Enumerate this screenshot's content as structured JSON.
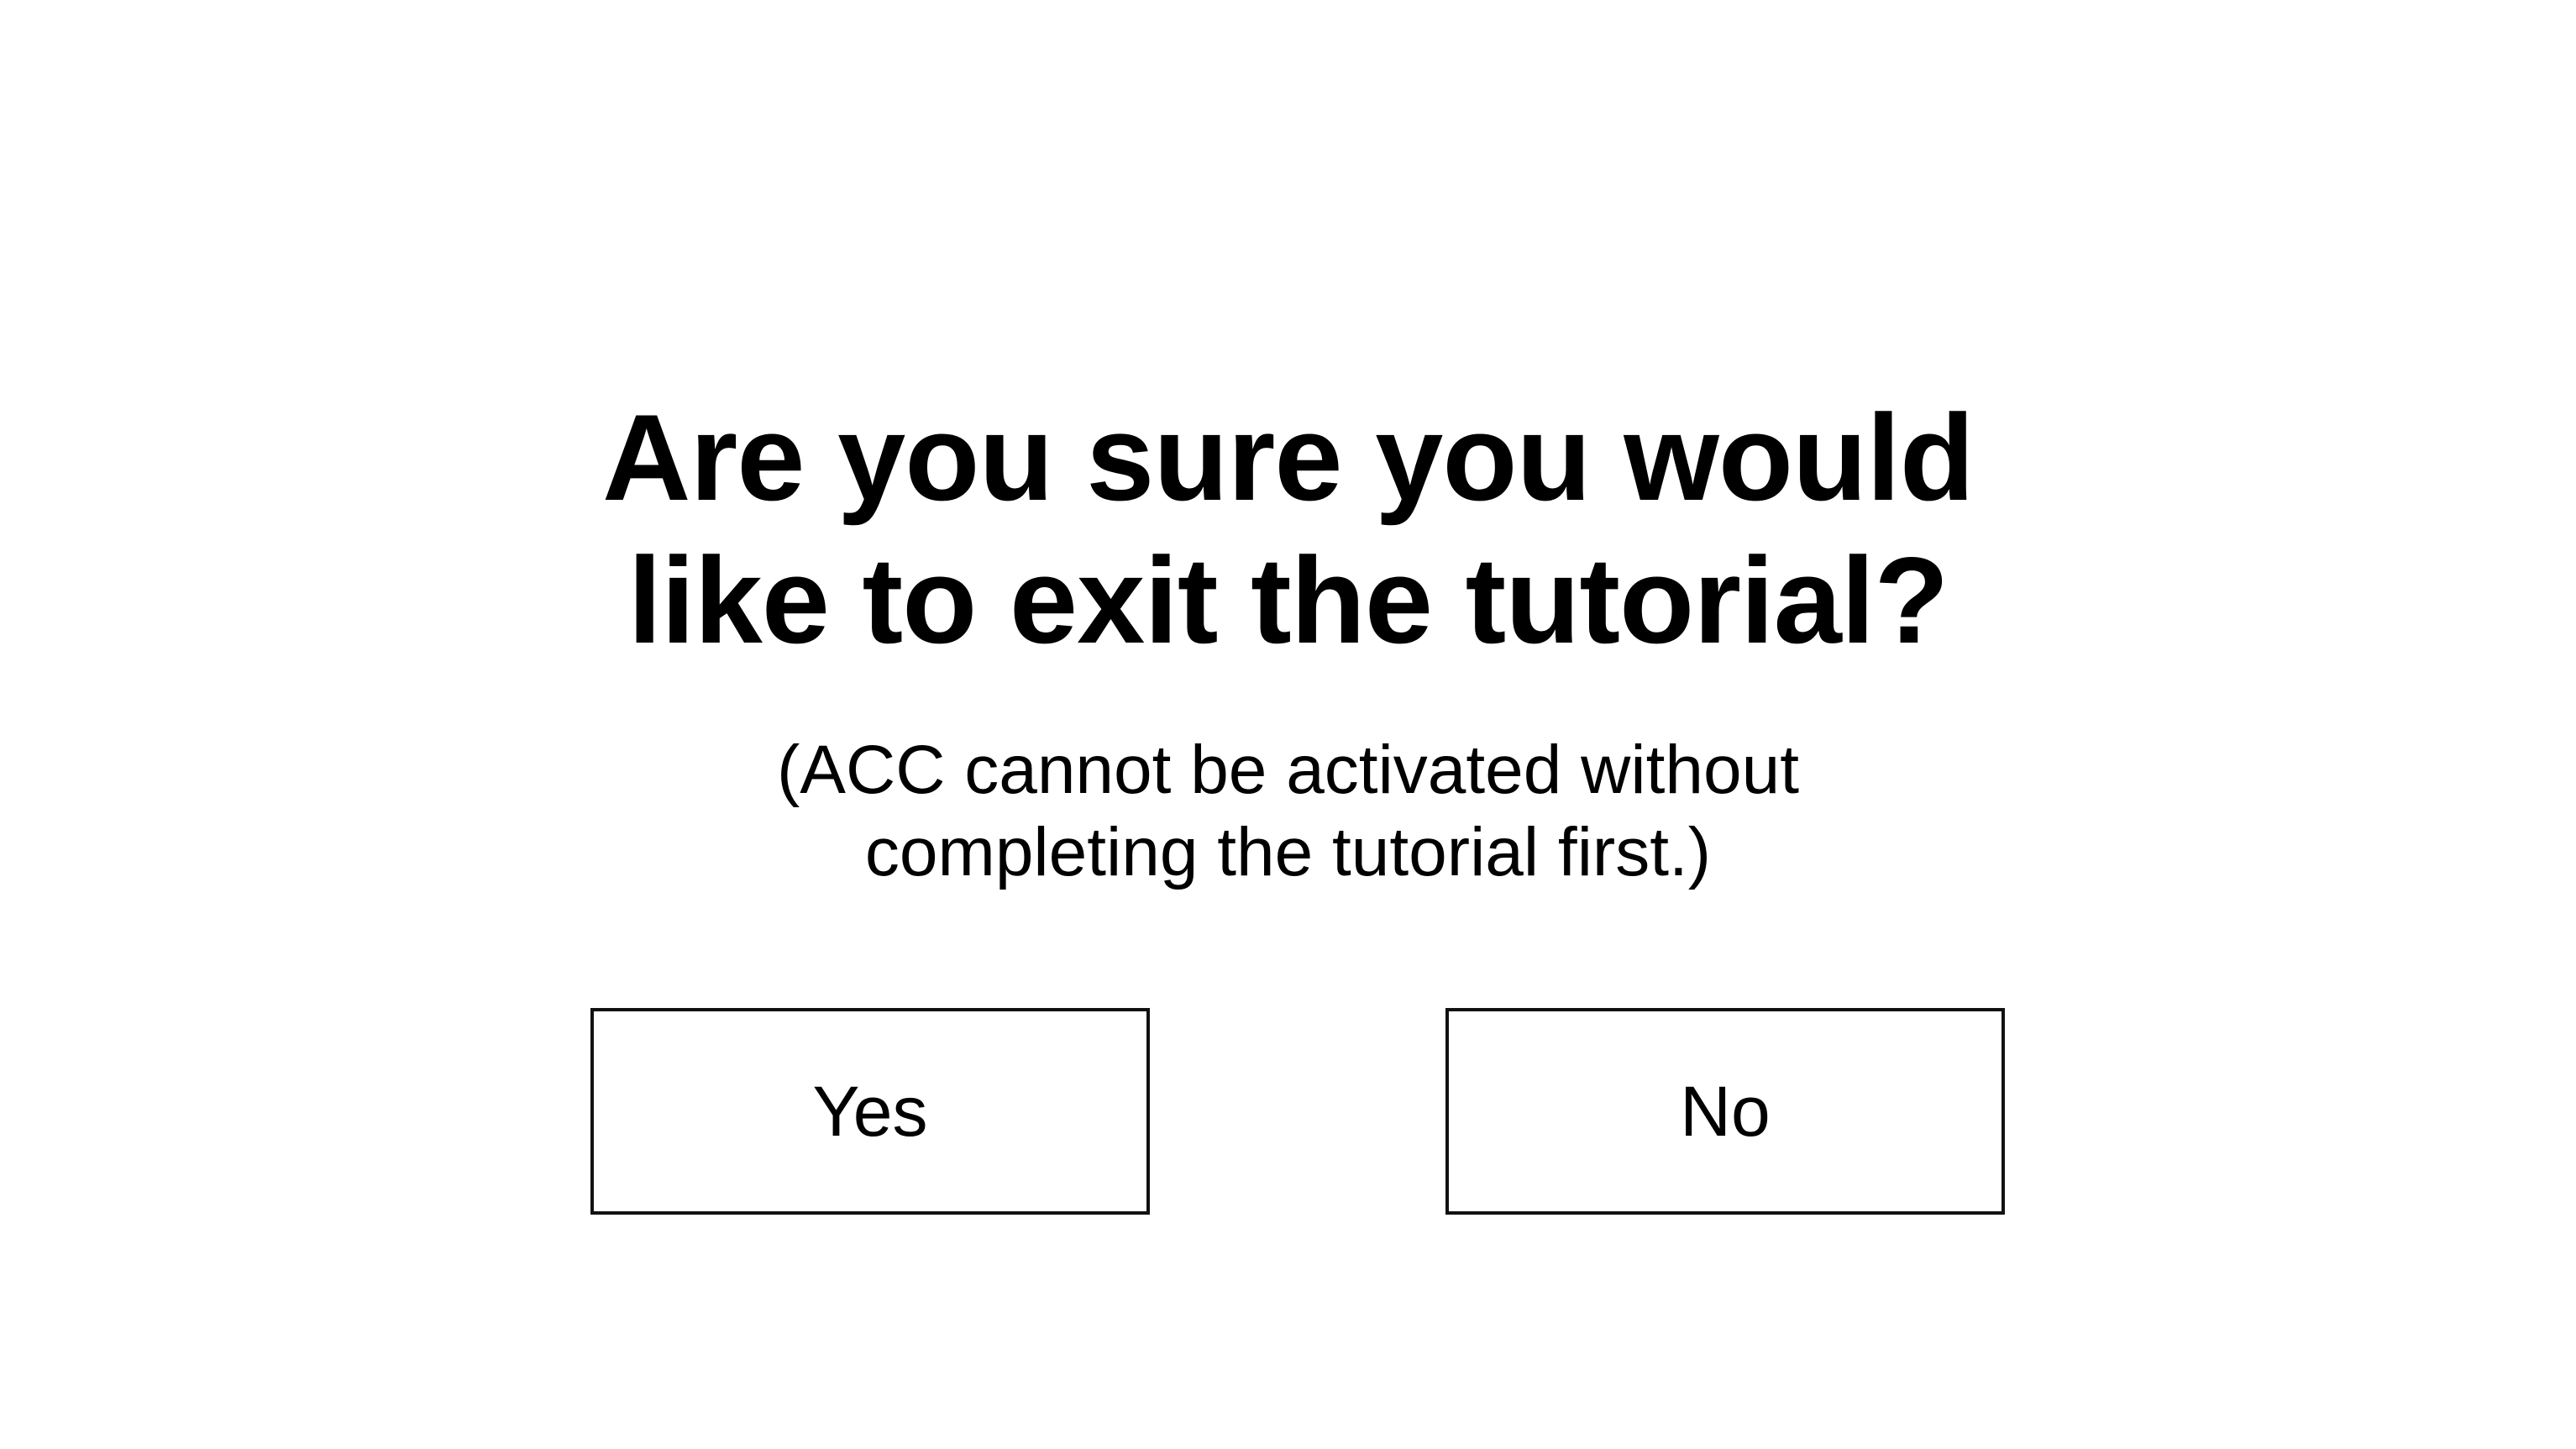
{
  "dialog": {
    "title_line1": "Are you sure you would",
    "title_line2": "like to exit the tutorial?",
    "subtitle_line1": "(ACC cannot be activated without",
    "subtitle_line2": "completing the tutorial first.)",
    "yes_label": "Yes",
    "no_label": "No"
  },
  "colors": {
    "background": "#ffffff",
    "text": "#000000",
    "button_border": "#111111"
  }
}
